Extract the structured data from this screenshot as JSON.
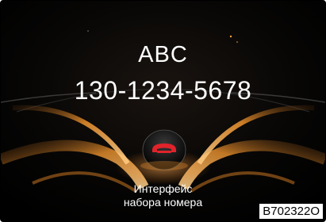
{
  "call": {
    "contact_name": "ABC",
    "phone_number": "130-1234-5678"
  },
  "hangup_button": {
    "icon": "phone-hangup-icon",
    "color": "#e0232b"
  },
  "caption": {
    "line1": "Интерфейс",
    "line2": "набора номера"
  },
  "figure_code": "B702322O",
  "colors": {
    "background": "#000000",
    "accent_glow": "#e08a2a",
    "text": "#ffffff"
  }
}
